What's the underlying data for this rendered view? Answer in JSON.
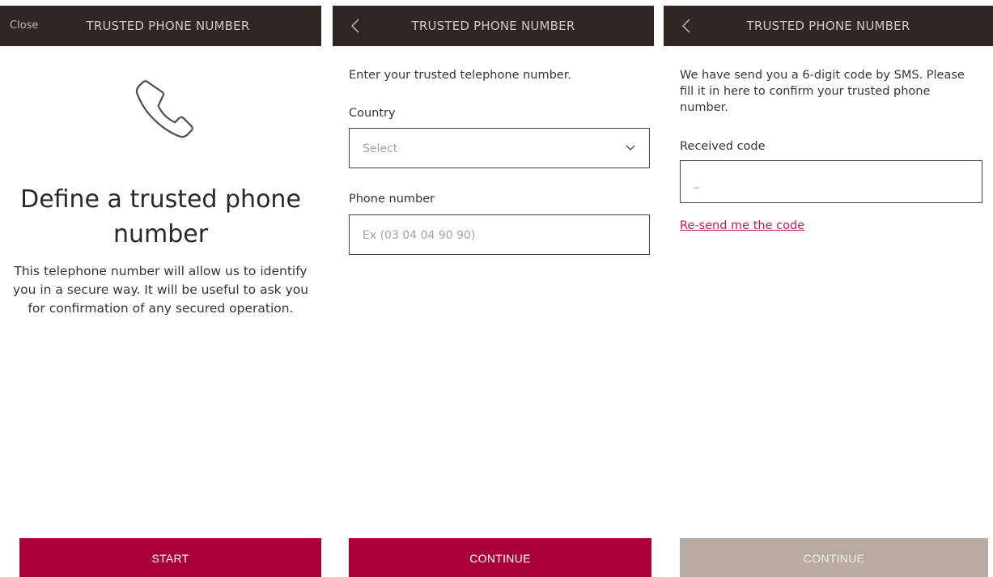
{
  "header_title": "TRUSTED PHONE NUMBER",
  "screen1": {
    "close_label": "Close",
    "icon": "phone-icon",
    "heading": "Define a trusted phone number",
    "description": "This telephone number will allow us to identify you in a secure way. It will be useful to ask you for confirmation of any secured operation.",
    "button_label": "START"
  },
  "screen2": {
    "back_icon": "chevron-left-icon",
    "intro": "Enter your trusted telephone number.",
    "country_label": "Country",
    "country_value": "Select",
    "phone_label": "Phone number",
    "phone_placeholder": "Ex (03 04 04 90 90)",
    "button_label": "CONTINUE"
  },
  "screen3": {
    "back_icon": "chevron-left-icon",
    "intro": "We have send you a 6-digit code by SMS. Please fill it in here to confirm your trusted phone number.",
    "code_label": "Received code",
    "code_placeholder": "_",
    "resend_link": "Re-send me the code",
    "button_label": "CONTINUE"
  },
  "colors": {
    "header_bg": "#2f2724",
    "primary_button": "#a9003c",
    "disabled_button": "#b8aca2",
    "link": "#c2185b"
  }
}
